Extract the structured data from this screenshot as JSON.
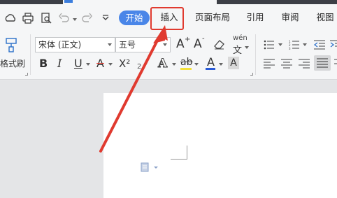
{
  "menu": {
    "start": "开始",
    "insert": "插入",
    "page_layout": "页面布局",
    "references": "引用",
    "review": "审阅",
    "view": "视图"
  },
  "ribbon": {
    "format_painter": "格式刷",
    "font_name": "宋体 (正文)",
    "font_size": "五号",
    "bold": "B",
    "italic": "I",
    "underline": "U",
    "strike": "A",
    "superscript": "X²",
    "grow_font": "A",
    "shrink_font": "A",
    "phonetic": "wén",
    "font_color": "A",
    "highlight": "ab",
    "char_shading": "A"
  },
  "colors": {
    "accent": "#4a86e8",
    "annotation_red": "#e03a2f",
    "highlight_yellow": "#f3e03a",
    "font_red": "#e03a2f",
    "font_blue": "#2a5bd7"
  }
}
